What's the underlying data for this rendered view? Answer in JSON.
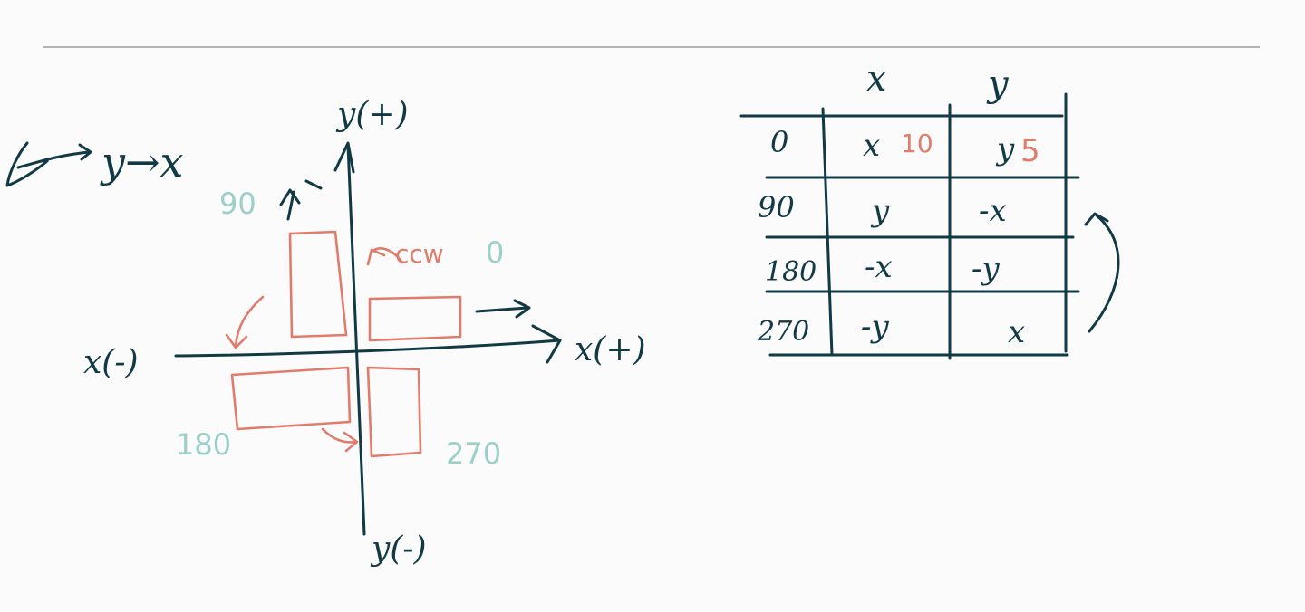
{
  "colors": {
    "ink": "#123a45",
    "accent": "#e07c6c",
    "teal": "#9bcfc8",
    "background": "#fbfbfb"
  },
  "note_left": {
    "text": "y→x"
  },
  "axes": {
    "y_pos": "y(+)",
    "y_neg": "y(-)",
    "x_neg": "x(-)",
    "x_pos": "x(+)"
  },
  "angles": {
    "a90": "90",
    "a0": "0",
    "a180": "180",
    "a270": "270"
  },
  "rotation_label": "ccw",
  "table": {
    "headers": [
      "x",
      "y"
    ],
    "rows": [
      {
        "angle": "0",
        "x": "x",
        "y": "y",
        "x_note": "10",
        "y_note": "5"
      },
      {
        "angle": "90",
        "x": "y",
        "y": "-x"
      },
      {
        "angle": "180",
        "x": "-x",
        "y": "-y"
      },
      {
        "angle": "270",
        "x": "-y",
        "y": "x"
      }
    ]
  }
}
